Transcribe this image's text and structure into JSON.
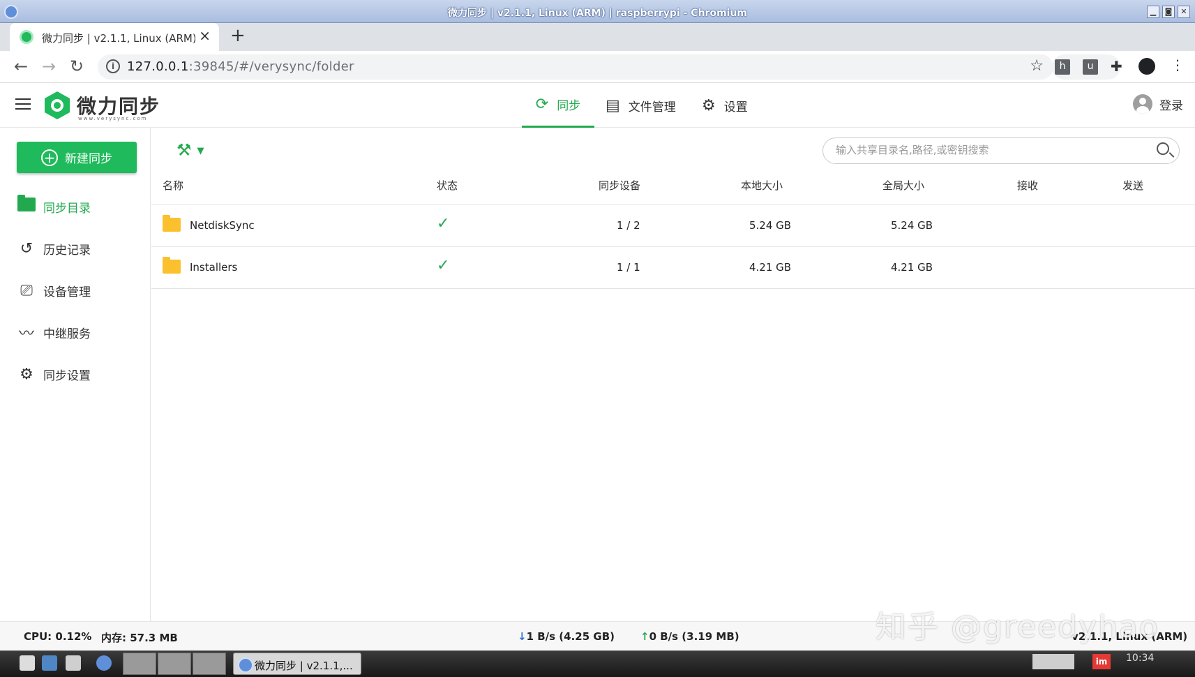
{
  "window": {
    "title": "微力同步 | v2.1.1, Linux (ARM) | raspberrypi - Chromium",
    "buttons": [
      "▁",
      "◙",
      "✕"
    ]
  },
  "browser": {
    "tab_title": "微力同步 | v2.1.1, Linux (ARM)",
    "url_host": "127.0.0.1",
    "url_rest": ":39845/#/verysync/folder",
    "extensions": [
      "h",
      "u"
    ]
  },
  "app": {
    "brand": "微力同步",
    "brand_sub": "www.verysync.com",
    "nav": {
      "sync": "同步",
      "files": "文件管理",
      "settings": "设置"
    },
    "login": "登录",
    "accent": "#1fba5b"
  },
  "sidebar": {
    "new_sync": "新建同步",
    "items": [
      {
        "label": "同步目录",
        "icon": "folder-icon",
        "active": true
      },
      {
        "label": "历史记录",
        "icon": "history-icon",
        "active": false
      },
      {
        "label": "设备管理",
        "icon": "device-icon",
        "active": false
      },
      {
        "label": "中继服务",
        "icon": "relay-icon",
        "active": false
      },
      {
        "label": "同步设置",
        "icon": "gear-icon",
        "active": false
      }
    ]
  },
  "main": {
    "search_placeholder": "输入共享目录名,路径,或密钥搜索",
    "columns": {
      "name": "名称",
      "status": "状态",
      "devices": "同步设备",
      "local_size": "本地大小",
      "global_size": "全局大小",
      "receive": "接收",
      "send": "发送"
    },
    "rows": [
      {
        "name": "NetdiskSync",
        "status": "✓",
        "devices": "1 / 2",
        "local_size": "5.24 GB",
        "global_size": "5.24 GB"
      },
      {
        "name": "Installers",
        "status": "✓",
        "devices": "1 / 1",
        "local_size": "4.21 GB",
        "global_size": "4.21 GB"
      }
    ]
  },
  "status": {
    "cpu": "CPU: 0.12%",
    "mem": "内存: 57.3 MB",
    "down": "1 B/s (4.25 GB)",
    "up": "0 B/s (3.19 MB)",
    "version": "v2.1.1, Linux (ARM)"
  },
  "watermark": "知乎 @greedyhao",
  "taskbar": {
    "task_title": "微力同步 | v2.1.1,...",
    "clock": "10:34",
    "tray_label": "im"
  }
}
